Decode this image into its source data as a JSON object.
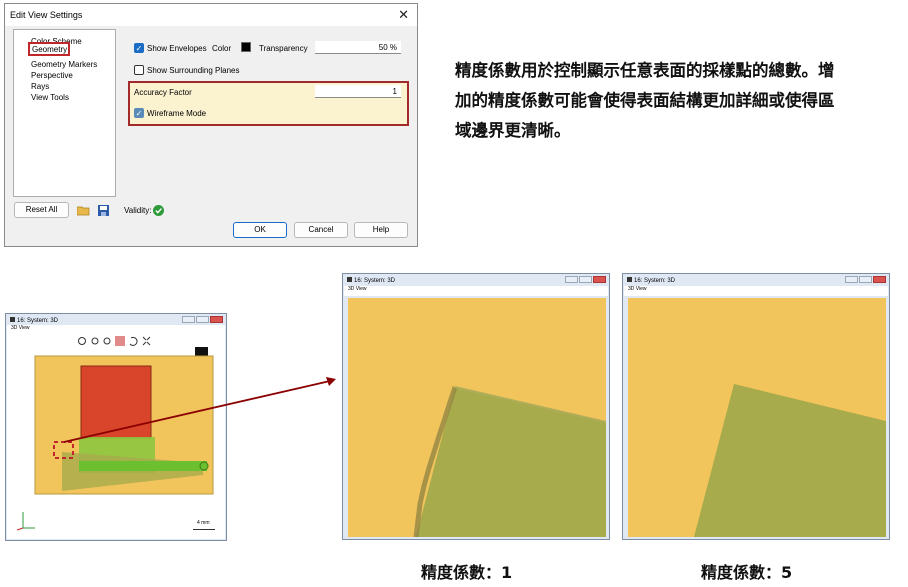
{
  "dialog": {
    "title": "Edit View Settings",
    "close_glyph": "✕",
    "tree": [
      "Color Scheme",
      "Geometry",
      "Geometry Markers",
      "Perspective",
      "Rays",
      "View Tools"
    ],
    "selected": "Geometry",
    "show_envelopes": "Show Envelopes",
    "color": "Color",
    "transparency": "Transparency",
    "transparency_value": "50 %",
    "show_surrounding": "Show Surrounding Planes",
    "accuracy_factor": "Accuracy Factor",
    "accuracy_value": "1",
    "wireframe": "Wireframe Mode",
    "reset_all": "Reset All",
    "validity": "Validity:",
    "ok": "OK",
    "cancel": "Cancel",
    "help": "Help"
  },
  "description": "精度係數用於控制顯示任意表面的採樣點的總數。增加的精度係數可能會使得表面結構更加詳細或使得區域邊界更清晰。",
  "small_window": {
    "title": "16: System: 3D",
    "menu": "3D View",
    "scale": "4 mm"
  },
  "zoom_window_1": {
    "title": "16: System: 3D",
    "menu": "3D View"
  },
  "zoom_window_2": {
    "title": "16: System: 3D",
    "menu": "3D View"
  },
  "caption_1": "精度係數：1",
  "caption_2": "精度係數：5",
  "colors": {
    "bg": "#f2c45c",
    "plate": "#a8ab4c",
    "red": "#d9452a",
    "green": "#6cbf2f",
    "highlight": "#a32a2a"
  }
}
